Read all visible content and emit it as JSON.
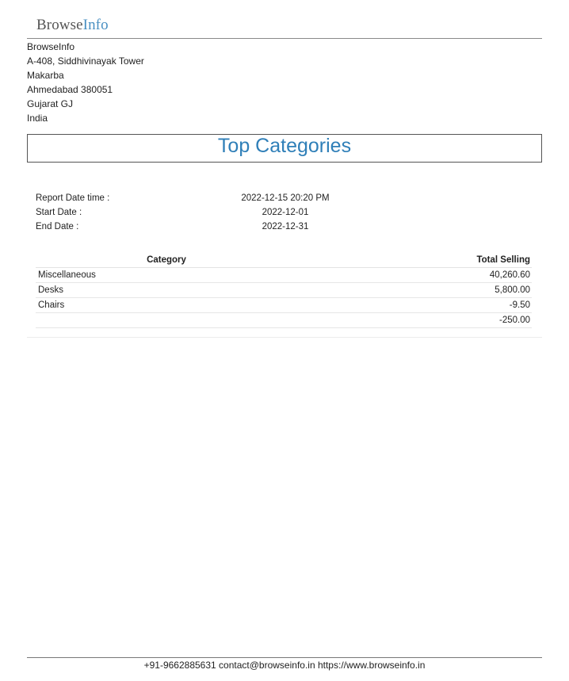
{
  "header": {
    "logo_part1": "Browse",
    "logo_part2": "Info"
  },
  "company": {
    "name": "BrowseInfo",
    "address_line1": "A-408, Siddhivinayak Tower",
    "address_line2": "Makarba",
    "address_line3": "Ahmedabad 380051",
    "address_line4": "Gujarat GJ",
    "country": "India"
  },
  "report": {
    "title": "Top Categories",
    "info": [
      {
        "label": "Report Date time :",
        "value": "2022-12-15 20:20 PM"
      },
      {
        "label": "Start Date :",
        "value": "2022-12-01"
      },
      {
        "label": "End Date :",
        "value": "2022-12-31"
      }
    ],
    "table": {
      "columns": [
        "Category",
        "Total Selling"
      ],
      "rows": [
        {
          "category": "Miscellaneous",
          "total": "40,260.60"
        },
        {
          "category": "Desks",
          "total": "5,800.00"
        },
        {
          "category": "Chairs",
          "total": "-9.50"
        },
        {
          "category": "",
          "total": "-250.00"
        }
      ]
    }
  },
  "footer": {
    "phone": "+91-9662885631",
    "email": "contact@browseinfo.in",
    "website": "https://www.browseinfo.in"
  },
  "colors": {
    "title": "#2f7fb8",
    "logo_info": "#4a90c2",
    "logo_browse": "#555555"
  }
}
